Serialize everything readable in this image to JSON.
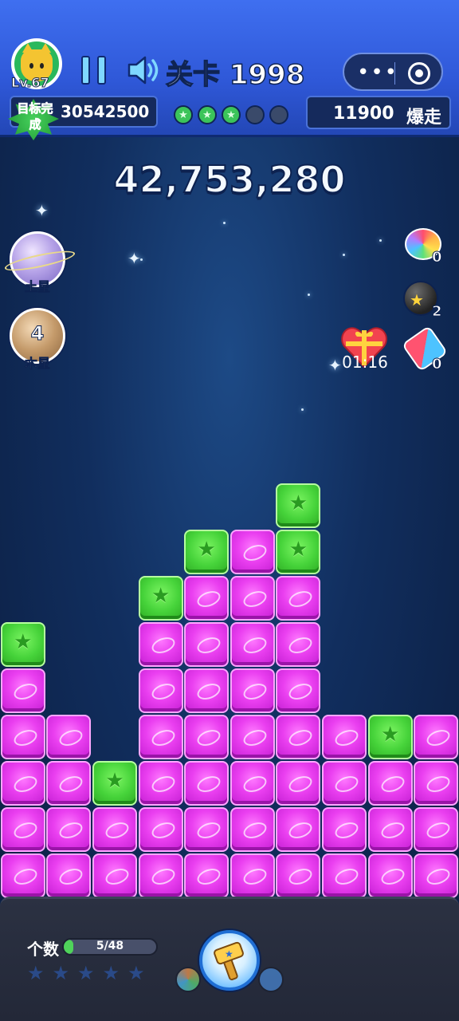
{
  "header": {
    "player_level": "Lv.67",
    "level_title": "关卡 1998",
    "target_score": "30542500",
    "goal_badge": "目标完成",
    "stars_earned": 3,
    "stars_total": 5,
    "frenzy_score": "11900",
    "frenzy_label": "爆走",
    "menu_icon": "more-dots-icon",
    "close_icon": "target-close-icon"
  },
  "score": {
    "current": "42,753,280"
  },
  "planets": [
    {
      "name": "土星",
      "icon": "saturn-icon"
    },
    {
      "name": "木星",
      "icon": "jupiter-icon",
      "count": "4"
    }
  ],
  "powerups": {
    "rainbow": {
      "icon": "rainbow-ball-icon",
      "count": "0"
    },
    "bomb": {
      "icon": "bomb-icon",
      "count": "2"
    },
    "rocket": {
      "icon": "rocket-icon",
      "count": "0"
    },
    "gift_timer": "01:16"
  },
  "board": {
    "cols": 10,
    "rows": 9,
    "grid": [
      [
        "",
        "",
        "",
        "",
        "",
        "",
        "G",
        "",
        "",
        ""
      ],
      [
        "",
        "",
        "",
        "",
        "G",
        "P",
        "G",
        "",
        "",
        ""
      ],
      [
        "",
        "",
        "",
        "G",
        "P",
        "P",
        "P",
        "",
        "",
        ""
      ],
      [
        "G",
        "",
        "",
        "P",
        "P",
        "P",
        "P",
        "",
        "",
        ""
      ],
      [
        "P",
        "",
        "",
        "P",
        "P",
        "P",
        "P",
        "",
        "",
        ""
      ],
      [
        "P",
        "P",
        "",
        "P",
        "P",
        "P",
        "P",
        "P",
        "G",
        "P"
      ],
      [
        "P",
        "P",
        "G",
        "P",
        "P",
        "P",
        "P",
        "P",
        "P",
        "P"
      ],
      [
        "P",
        "P",
        "P",
        "P",
        "P",
        "P",
        "P",
        "P",
        "P",
        "P"
      ],
      [
        "P",
        "P",
        "P",
        "P",
        "P",
        "P",
        "P",
        "P",
        "P",
        "P"
      ]
    ]
  },
  "footer": {
    "count_label": "个数",
    "progress_text": "5/48",
    "progress_value": 5,
    "progress_max": 48,
    "stars_count": 5,
    "hammer_icon": "hammer-icon"
  },
  "colors": {
    "pink_block": "#ea3ff0",
    "green_block": "#46d33a",
    "header_blue": "#2f58d8"
  }
}
